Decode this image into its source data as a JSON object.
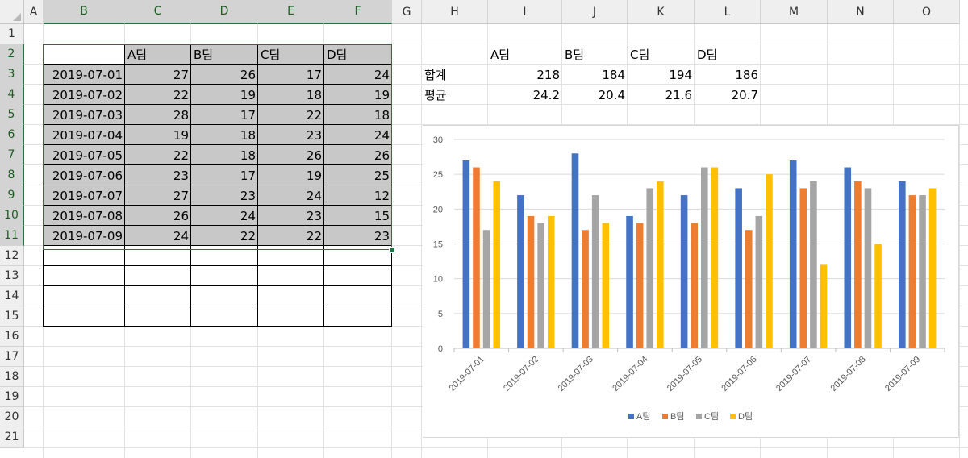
{
  "sheet": {
    "columns": [
      "A",
      "B",
      "C",
      "D",
      "E",
      "F",
      "G",
      "H",
      "I",
      "J",
      "K",
      "L",
      "M",
      "N",
      "O"
    ],
    "rows": [
      "1",
      "2",
      "3",
      "4",
      "5",
      "6",
      "7",
      "8",
      "9",
      "10",
      "11",
      "12",
      "13",
      "14",
      "15",
      "16",
      "17",
      "18",
      "19",
      "20",
      "21"
    ]
  },
  "table": {
    "headers": [
      "A팀",
      "B팀",
      "C팀",
      "D팀"
    ],
    "rows": [
      {
        "date": "2019-07-01",
        "values": [
          "27",
          "26",
          "17",
          "24"
        ]
      },
      {
        "date": "2019-07-02",
        "values": [
          "22",
          "19",
          "18",
          "19"
        ]
      },
      {
        "date": "2019-07-03",
        "values": [
          "28",
          "17",
          "22",
          "18"
        ]
      },
      {
        "date": "2019-07-04",
        "values": [
          "19",
          "18",
          "23",
          "24"
        ]
      },
      {
        "date": "2019-07-05",
        "values": [
          "22",
          "18",
          "26",
          "26"
        ]
      },
      {
        "date": "2019-07-06",
        "values": [
          "23",
          "17",
          "19",
          "25"
        ]
      },
      {
        "date": "2019-07-07",
        "values": [
          "27",
          "23",
          "24",
          "12"
        ]
      },
      {
        "date": "2019-07-08",
        "values": [
          "26",
          "24",
          "23",
          "15"
        ]
      },
      {
        "date": "2019-07-09",
        "values": [
          "24",
          "22",
          "22",
          "23"
        ]
      }
    ]
  },
  "summary": {
    "headers": [
      "A팀",
      "B팀",
      "C팀",
      "D팀"
    ],
    "sum_label": "합계",
    "sum_values": [
      "218",
      "184",
      "194",
      "186"
    ],
    "avg_label": "평균",
    "avg_values": [
      "24.2",
      "20.4",
      "21.6",
      "20.7"
    ]
  },
  "colors": {
    "selection": "#217346",
    "series": [
      "#4472C4",
      "#ED7D31",
      "#A5A5A5",
      "#FFC000"
    ]
  },
  "chart_data": {
    "type": "bar",
    "categories": [
      "2019-07-01",
      "2019-07-02",
      "2019-07-03",
      "2019-07-04",
      "2019-07-05",
      "2019-07-06",
      "2019-07-07",
      "2019-07-08",
      "2019-07-09"
    ],
    "series": [
      {
        "name": "A팀",
        "values": [
          27,
          22,
          28,
          19,
          22,
          23,
          27,
          26,
          24
        ]
      },
      {
        "name": "B팀",
        "values": [
          26,
          19,
          17,
          18,
          18,
          17,
          23,
          24,
          22
        ]
      },
      {
        "name": "C팀",
        "values": [
          17,
          18,
          22,
          23,
          26,
          19,
          24,
          23,
          22
        ]
      },
      {
        "name": "D팀",
        "values": [
          24,
          19,
          18,
          24,
          26,
          25,
          12,
          15,
          23
        ]
      }
    ],
    "ylim": [
      0,
      30
    ],
    "yticks": [
      "0",
      "5",
      "10",
      "15",
      "20",
      "25",
      "30"
    ],
    "grid": true,
    "legend": "bottom",
    "title": "",
    "xlabel": "",
    "ylabel": ""
  }
}
